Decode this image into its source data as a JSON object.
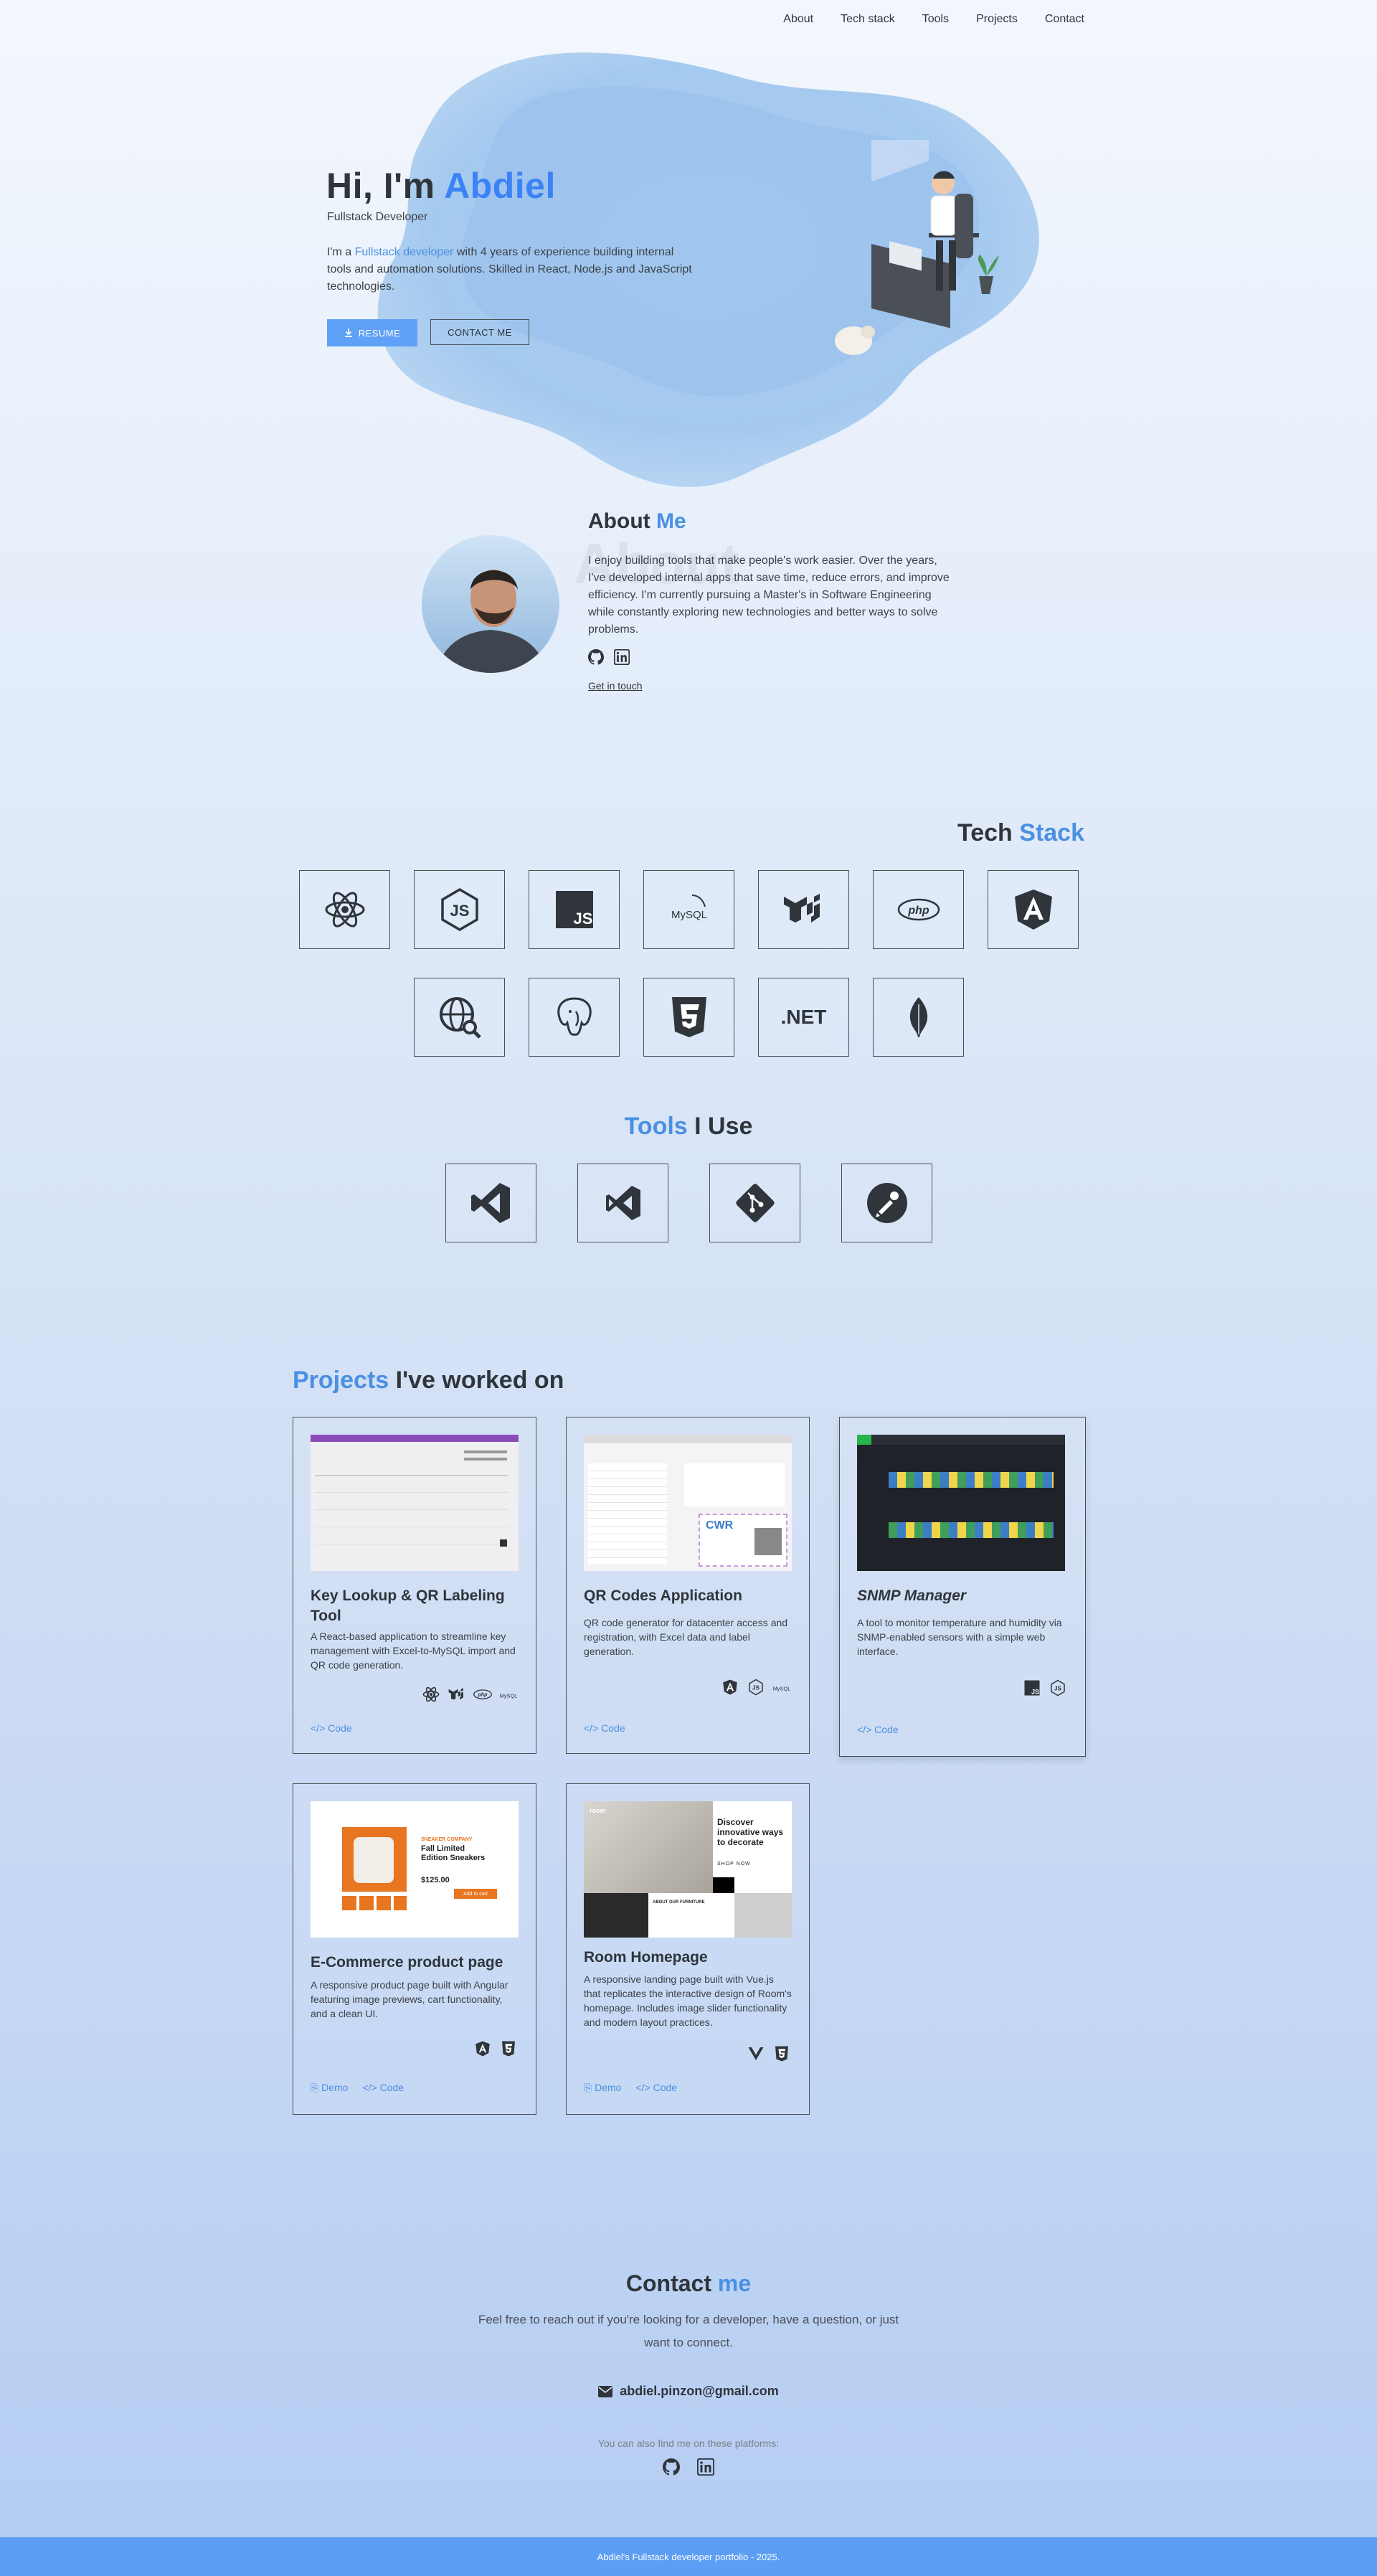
{
  "nav": [
    "About",
    "Tech stack",
    "Tools",
    "Projects",
    "Contact"
  ],
  "hero": {
    "greeting": "Hi, I'm ",
    "name": "Abdiel",
    "role": "Fullstack Developer",
    "desc_pre": "I'm a ",
    "desc_accent": "Fullstack developer",
    "desc_post": " with 4 years of experience building internal tools and automation solutions. Skilled in React, Node.js and JavaScript technologies.",
    "resume_label": "RESUME",
    "contact_label": "CONTACT ME"
  },
  "about": {
    "title_a": "About ",
    "title_b": "Me",
    "watermark": "About",
    "text": "I enjoy building tools that make people's work easier. Over the years, I've developed internal apps that save time, reduce errors, and improve efficiency. I'm currently pursuing a Master's in Software Engineering while constantly exploring new technologies and better ways to solve problems.",
    "cta": "Get in touch"
  },
  "tech": {
    "title_a": "Tech ",
    "title_b": "Stack",
    "items": [
      "react-icon",
      "nodejs-icon",
      "javascript-icon",
      "mysql-icon",
      "mui-icon",
      "php-icon",
      "angular-icon",
      "web-search-icon",
      "postgresql-icon",
      "css3-icon",
      ".NET",
      "mongodb-leaf-icon"
    ],
    "dotnet_label": ".NET",
    "mysql_label": "MySQL",
    "php_label": "php"
  },
  "tools": {
    "title_a": "Tools",
    "title_b": " I Use",
    "items": [
      "vscode-icon",
      "visual-studio-icon",
      "git-icon",
      "postman-icon"
    ]
  },
  "projects": {
    "title_a": "Projects",
    "title_b": " I've worked on",
    "list": [
      {
        "title": "Key Lookup & QR Labeling Tool",
        "desc": "A React-based application to streamline key management with Excel-to-MySQL import and QR code generation.",
        "tech": [
          "react-icon",
          "mui-icon",
          "php-icon",
          "mysql-icon"
        ],
        "links": [
          "Code"
        ]
      },
      {
        "title": "QR Codes Application",
        "desc": "QR code generator for datacenter access and registration, with Excel data and label generation.",
        "tech": [
          "angular-icon",
          "nodejs-icon",
          "mysql-icon"
        ],
        "links": [
          "Code"
        ]
      },
      {
        "title": "SNMP Manager",
        "desc": "A tool to monitor temperature and humidity via SNMP-enabled sensors with a simple web interface.",
        "tech": [
          "javascript-icon",
          "nodejs-icon"
        ],
        "links": [
          "Code"
        ]
      },
      {
        "title": "E-Commerce product page",
        "desc": "A responsive product page built with Angular featuring image previews, cart functionality, and a clean UI.",
        "tech": [
          "angular-icon",
          "css3-icon"
        ],
        "links": [
          "Demo",
          "Code"
        ]
      },
      {
        "title": "Room Homepage",
        "desc": "A responsive landing page built with Vue.js that replicates the interactive design of Room's homepage. Includes image slider functionality and modern layout practices.",
        "tech": [
          "vue-icon",
          "css3-icon"
        ],
        "links": [
          "Demo",
          "Code"
        ]
      }
    ],
    "shot_texts": {
      "qr_brand": "CWR",
      "ecom_tag": "SNEAKER COMPANY",
      "ecom_title": "Fall Limited Edition Sneakers",
      "ecom_price": "$125.00",
      "ecom_cart": "Add to cart",
      "room_headline": "Discover innovative ways to decorate",
      "room_logo": "room",
      "room_shop": "SHOP NOW",
      "room_about": "ABOUT OUR FURNITURE"
    }
  },
  "contact": {
    "title_a": "Contact ",
    "title_b": "me",
    "desc": "Feel free to reach out if you're looking for a developer, have a question, or just want to connect.",
    "email": "abdiel.pinzon@gmail.com",
    "also": "You can also find me on these platforms:"
  },
  "footer": "Abdiel's Fullstack developer portfolio - 2025.",
  "colors": {
    "accent": "#3b82f6",
    "button": "#5ea1f7",
    "footer": "#5b9ef4",
    "text": "#2f353b"
  }
}
